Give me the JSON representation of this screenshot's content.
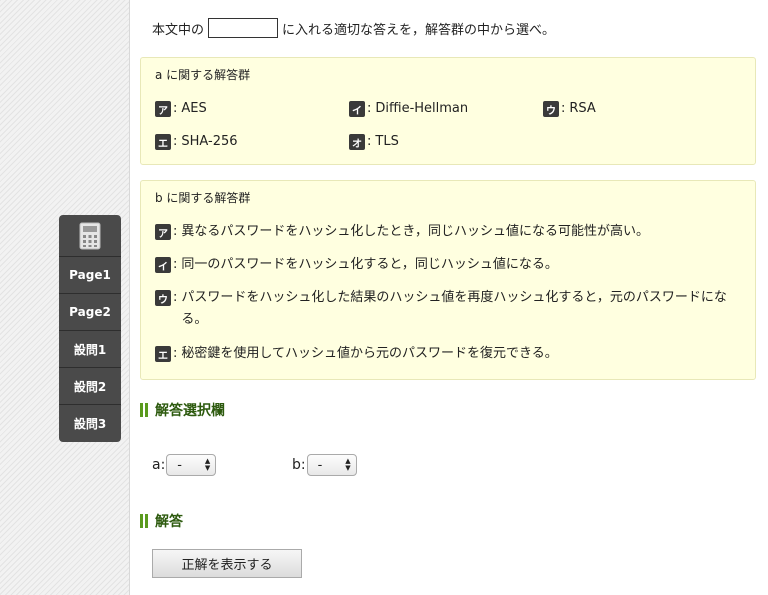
{
  "question": {
    "text_before": "本文中の",
    "text_after": "に入れる適切な答えを，解答群の中から選べ。"
  },
  "panel_a": {
    "title": "a に関する解答群",
    "choices": [
      {
        "key": "ア",
        "text": "AES"
      },
      {
        "key": "イ",
        "text": "Diffie-Hellman"
      },
      {
        "key": "ウ",
        "text": "RSA"
      },
      {
        "key": "エ",
        "text": "SHA-256"
      },
      {
        "key": "オ",
        "text": "TLS"
      }
    ]
  },
  "panel_b": {
    "title": "b に関する解答群",
    "choices": [
      {
        "key": "ア",
        "text": "異なるパスワードをハッシュ化したとき，同じハッシュ値になる可能性が高い。"
      },
      {
        "key": "イ",
        "text": "同一のパスワードをハッシュ化すると，同じハッシュ値になる。"
      },
      {
        "key": "ウ",
        "text": "パスワードをハッシュ化した結果のハッシュ値を再度ハッシュ化すると，元のパスワードになる。"
      },
      {
        "key": "エ",
        "text": "秘密鍵を使用してハッシュ値から元のパスワードを復元できる。"
      }
    ]
  },
  "colon": ":",
  "selection_heading": "解答選択欄",
  "selects": [
    {
      "label": "a:",
      "value": "-"
    },
    {
      "label": "b:",
      "value": "-"
    }
  ],
  "answer_heading": "解答",
  "show_answer_label": "正解を表示する",
  "sidenav": {
    "items": [
      "Page1",
      "Page2",
      "設問1",
      "設問2",
      "設問3"
    ]
  }
}
